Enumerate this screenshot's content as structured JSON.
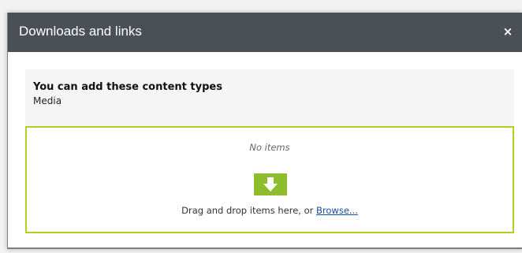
{
  "dialog": {
    "title": "Downloads and links",
    "close_label": "×"
  },
  "content_info": {
    "heading": "You can add these content types",
    "types": "Media"
  },
  "dropzone": {
    "empty_text": "No items",
    "instruction_text": "Drag and drop items here, or ",
    "browse_label": "Browse...",
    "arrow_icon": "arrow-down-icon",
    "accent_color": "#b4cf1e",
    "arrow_bg_color": "#8dbd2c"
  }
}
